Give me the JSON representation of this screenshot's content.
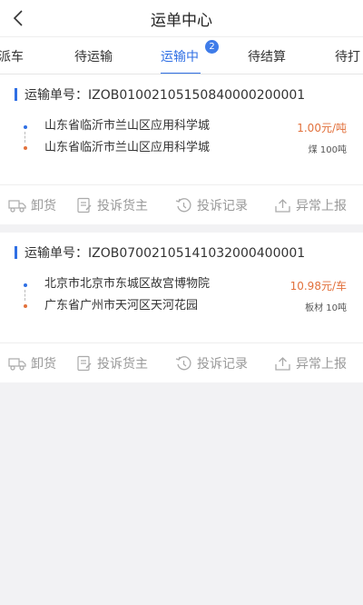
{
  "header": {
    "title": "运单中心"
  },
  "tabs": [
    {
      "label": "派车"
    },
    {
      "label": "待运输"
    },
    {
      "label": "运输中",
      "badge": "2",
      "active": true
    },
    {
      "label": "待结算"
    },
    {
      "label": "待打"
    }
  ],
  "orders": [
    {
      "order_label": "运输单号：IZOB01002105150840000200001",
      "origin": "山东省临沂市兰山区应用科学城",
      "destination": "山东省临沂市兰山区应用科学城",
      "price": "1.00元/吨",
      "cargo": "煤 100吨"
    },
    {
      "order_label": "运输单号：IZOB07002105141032000400001",
      "origin": "北京市北京市东城区故宫博物院",
      "destination": "广东省广州市天河区天河花园",
      "price": "10.98元/车",
      "cargo": "板材 10吨"
    }
  ],
  "actions": {
    "unload": "卸货",
    "complain_owner": "投诉货主",
    "complaint_records": "投诉记录",
    "report_exception": "异常上报"
  },
  "colors": {
    "accent": "#2f6fe4",
    "price": "#e2713c",
    "muted": "#999999"
  }
}
